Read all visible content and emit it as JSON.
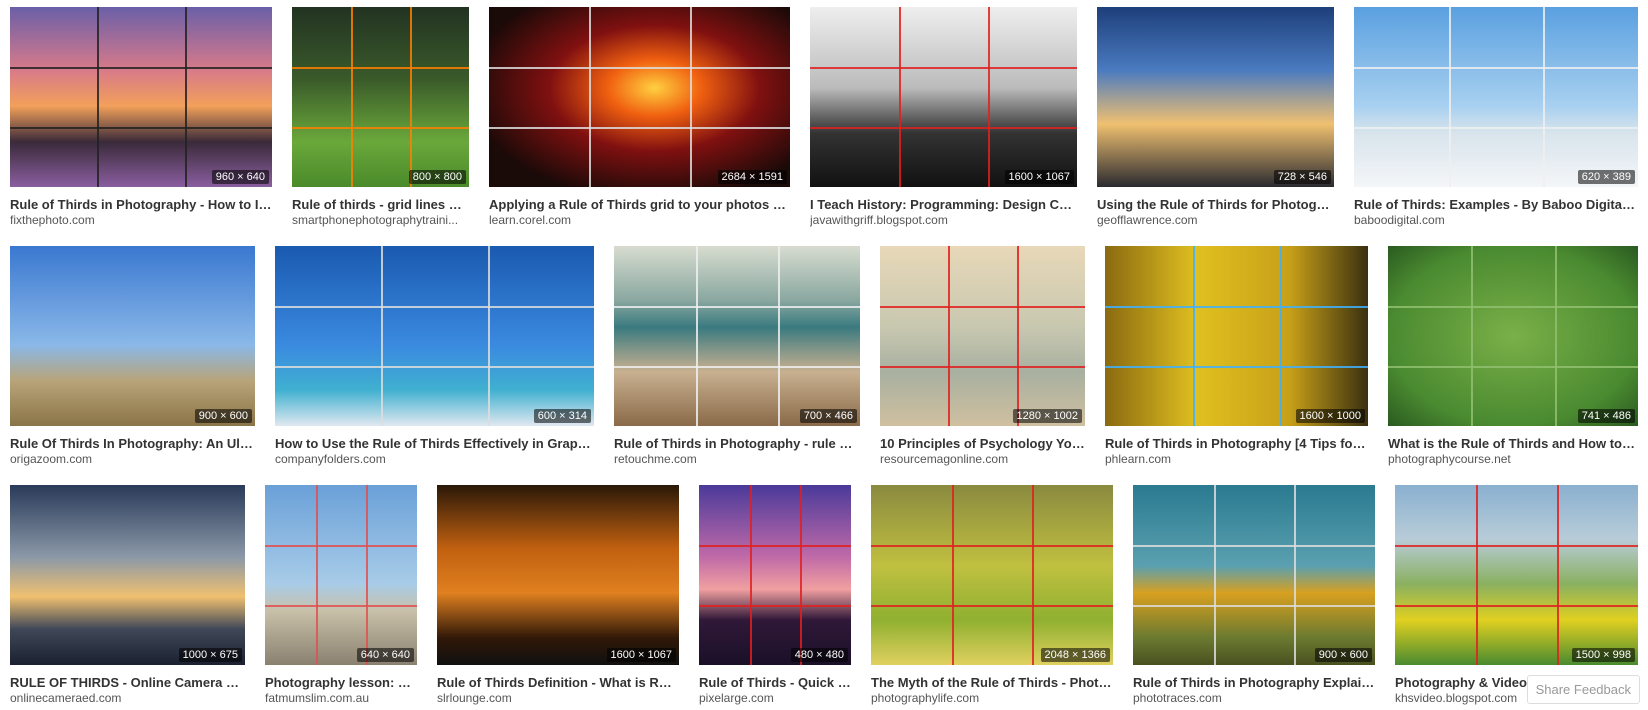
{
  "results": [
    {
      "title": "Rule of Thirds in Photography - How to Im...",
      "source": "fixthephoto.com",
      "dims": "960 × 640",
      "bg": "linear-gradient(180deg,#6a5fa8 0%,#d87a8a 35%,#f2a05a 55%,#3a2a3a 75%,#8a5ea0 100%)",
      "lineColor": "#222222"
    },
    {
      "title": "Rule of thirds - grid lines on ...",
      "source": "smartphonephotographytraini...",
      "dims": "800 × 800",
      "bg": "linear-gradient(180deg,#223322 0%,#3a5a2a 40%,#6aa83a 75%,#4a8a2a 100%)",
      "lineColor": "#ff7f00"
    },
    {
      "title": "Applying a Rule of Thirds grid to your photos - Co...",
      "source": "learn.corel.com",
      "dims": "2684 × 1591",
      "bg": "radial-gradient(ellipse at 55% 45%,#ffd040 0%,#f06010 20%,#801010 45%,#1a0a08 80%)",
      "lineColor": "#dddddd"
    },
    {
      "title": "I Teach History: Programming: Design Conc...",
      "source": "javawithgriff.blogspot.com",
      "dims": "1600 × 1067",
      "bg": "linear-gradient(180deg,#eeeeee 0%,#bbbbbb 45%,#333333 70%,#111111 100%)",
      "lineColor": "#e02020"
    },
    {
      "title": "Using the Rule of Thirds for Photograp...",
      "source": "geofflawrence.com",
      "dims": "728 × 546",
      "bg": "linear-gradient(180deg,#1d3f7a 0%,#4a7ac0 35%,#f0c070 65%,#2a2a30 100%)",
      "lineColor": "none"
    },
    {
      "title": "Rule of Thirds: Examples - By Baboo Digital Fin...",
      "source": "baboodigital.com",
      "dims": "620 × 389",
      "bg": "linear-gradient(180deg,#5aa0e0 0%,#a8d0f0 55%,#d8e4ec 70%,#f4f6f8 100%)",
      "lineColor": "#eeeeee"
    },
    {
      "title": "Rule Of Thirds In Photography: An Ultim...",
      "source": "origazoom.com",
      "dims": "900 × 600",
      "bg": "linear-gradient(180deg,#3a78d0 0%,#8ab8e8 55%,#b8a478 75%,#8a7448 100%)",
      "lineColor": "none"
    },
    {
      "title": "How to Use the Rule of Thirds Effectively in Graphic ...",
      "source": "companyfolders.com",
      "dims": "600 × 314",
      "bg": "linear-gradient(180deg,#1a5ab0 0%,#3a8ae0 55%,#40b0d0 80%,#e0e8f0 100%)",
      "lineColor": "#dddddd"
    },
    {
      "title": "Rule of Thirds in Photography - rule of 3...",
      "source": "retouchme.com",
      "dims": "700 × 466",
      "bg": "linear-gradient(180deg,#d8dcd0 0%,#8aa8a0 30%,#3a7a80 45%,#c8b090 70%,#8a6a48 100%)",
      "lineColor": "#eeeeee"
    },
    {
      "title": "10 Principles of Psychology You ...",
      "source": "resourcemagonline.com",
      "dims": "1280 × 1002",
      "bg": "linear-gradient(180deg,#e8d8b8 0%,#c8c8b0 45%,#a8b0a0 70%,#d0c0a0 100%)",
      "lineColor": "#e02020"
    },
    {
      "title": "Rule of Thirds in Photography [4 Tips for M...",
      "source": "phlearn.com",
      "dims": "1600 × 1000",
      "bg": "linear-gradient(90deg,#8a6a10 0%,#e0c020 35%,#c8a018 70%,#3a3010 100%)",
      "lineColor": "#40b0ff"
    },
    {
      "title": "What is the Rule of Thirds and How to U...",
      "source": "photographycourse.net",
      "dims": "741 × 486",
      "bg": "radial-gradient(ellipse at 50% 50%,#7ab048 0%,#4a8a30 70%,#2a5a20 100%)",
      "lineColor": "#90c070"
    },
    {
      "title": "RULE OF THIRDS - Online Camera Ed ...",
      "source": "onlinecameraed.com",
      "dims": "1000 × 675",
      "bg": "linear-gradient(180deg,#2a3a58 0%,#8a98a8 40%,#f0c070 62%,#404858 80%,#1a2030 100%)",
      "lineColor": "none"
    },
    {
      "title": "Photography lesson: Ma...",
      "source": "fatmumslim.com.au",
      "dims": "640 × 640",
      "bg": "linear-gradient(180deg,#6aa0d8 0%,#a8cce8 55%,#c8c0a8 70%,#8a8070 100%)",
      "lineColor": "#e05050"
    },
    {
      "title": "Rule of Thirds Definition - What is Rule ...",
      "source": "slrlounge.com",
      "dims": "1600 × 1067",
      "bg": "linear-gradient(180deg,#2a1808 0%,#c06010 35%,#e08020 60%,#301808 85%,#101010 100%)",
      "lineColor": "none"
    },
    {
      "title": "Rule of Thirds - Quick P...",
      "source": "pixelarge.com",
      "dims": "480 × 480",
      "bg": "linear-gradient(180deg,#4a3a9a 0%,#c06aa8 40%,#f0a0a0 58%,#301838 75%,#1a1028 100%)",
      "lineColor": "#e02020"
    },
    {
      "title": "The Myth of the Rule of Thirds - Photog...",
      "source": "photographylife.com",
      "dims": "2048 × 1366",
      "bg": "linear-gradient(180deg,#8a8a40 0%,#c0c040 45%,#90b030 75%,#e0d060 100%)",
      "lineColor": "#e02020"
    },
    {
      "title": "Rule of Thirds in Photography Explaine...",
      "source": "phototraces.com",
      "dims": "900 × 600",
      "bg": "linear-gradient(180deg,#2a7a90 0%,#5aa0b0 45%,#d8a020 60%,#6a7a30 85%,#4a5020 100%)",
      "lineColor": "#dddddd"
    },
    {
      "title": "Photography & Video Production: Com...",
      "source": "khsvideo.blogspot.com",
      "dims": "1500 × 998",
      "bg": "linear-gradient(180deg,#8ab0d0 0%,#b8ccd8 30%,#8ab060 55%,#e0d020 75%,#4a8a30 100%)",
      "lineColor": "#e02020"
    }
  ],
  "feedback_label": "Share Feedback"
}
